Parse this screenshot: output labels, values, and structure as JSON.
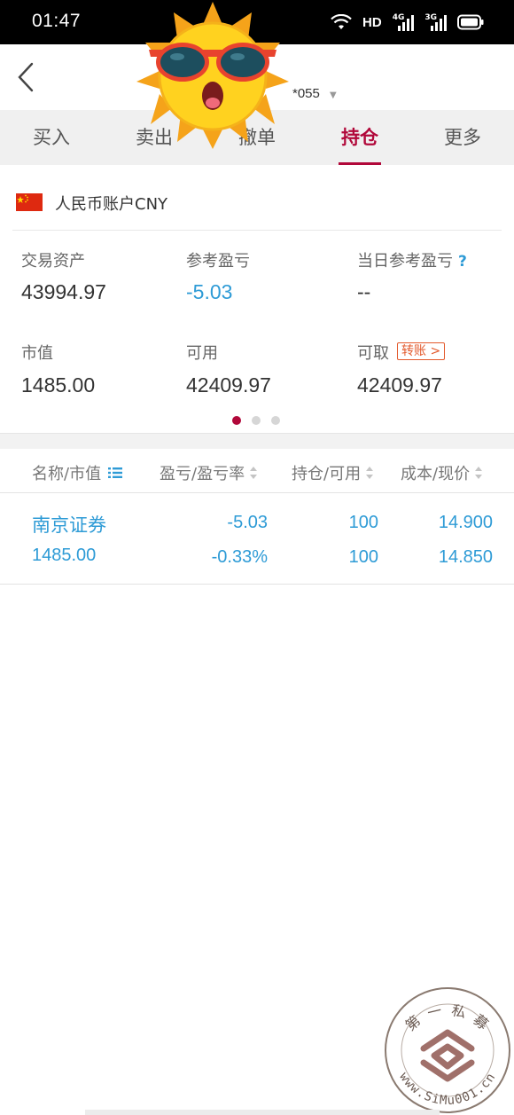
{
  "status_bar": {
    "time": "01:47",
    "hd_label": "HD",
    "net_4g": "4G",
    "net_3g": "3G"
  },
  "header": {
    "account_label": "*055",
    "back_icon": "chevron-left-icon"
  },
  "tabs": [
    {
      "label": "买入",
      "active": false
    },
    {
      "label": "卖出",
      "active": false
    },
    {
      "label": "撤单",
      "active": false
    },
    {
      "label": "持仓",
      "active": true
    },
    {
      "label": "更多",
      "active": false
    }
  ],
  "account": {
    "name": "人民币账户CNY",
    "flag_icon": "china-flag-icon"
  },
  "summary": {
    "trade_assets_label": "交易资产",
    "trade_assets_value": "43994.97",
    "ref_pnl_label": "参考盈亏",
    "ref_pnl_value": "-5.03",
    "day_ref_pnl_label": "当日参考盈亏",
    "day_ref_pnl_help": "?",
    "day_ref_pnl_value": "--",
    "market_value_label": "市值",
    "market_value_value": "1485.00",
    "available_label": "可用",
    "available_value": "42409.97",
    "withdrawable_label": "可取",
    "withdrawable_value": "42409.97",
    "transfer_label": "转账 >",
    "page_count": 3,
    "page_index": 0
  },
  "positions_table": {
    "columns": [
      "名称/市值",
      "盈亏/盈亏率",
      "持仓/可用",
      "成本/现价"
    ],
    "rows": [
      {
        "name": "南京证券",
        "market_value": "1485.00",
        "pnl": "-5.03",
        "pnl_rate": "-0.33%",
        "position": "100",
        "available": "100",
        "cost": "14.900",
        "price": "14.850"
      }
    ]
  },
  "watermark": {
    "text_top": "第 一 私 募",
    "text_bottom": "www.SiMu001.cn"
  },
  "colors": {
    "accent": "#b1083a",
    "value_blue": "#2e9bd6",
    "transfer_orange": "#e35a2d",
    "tab_bg": "#f0f0f0"
  }
}
